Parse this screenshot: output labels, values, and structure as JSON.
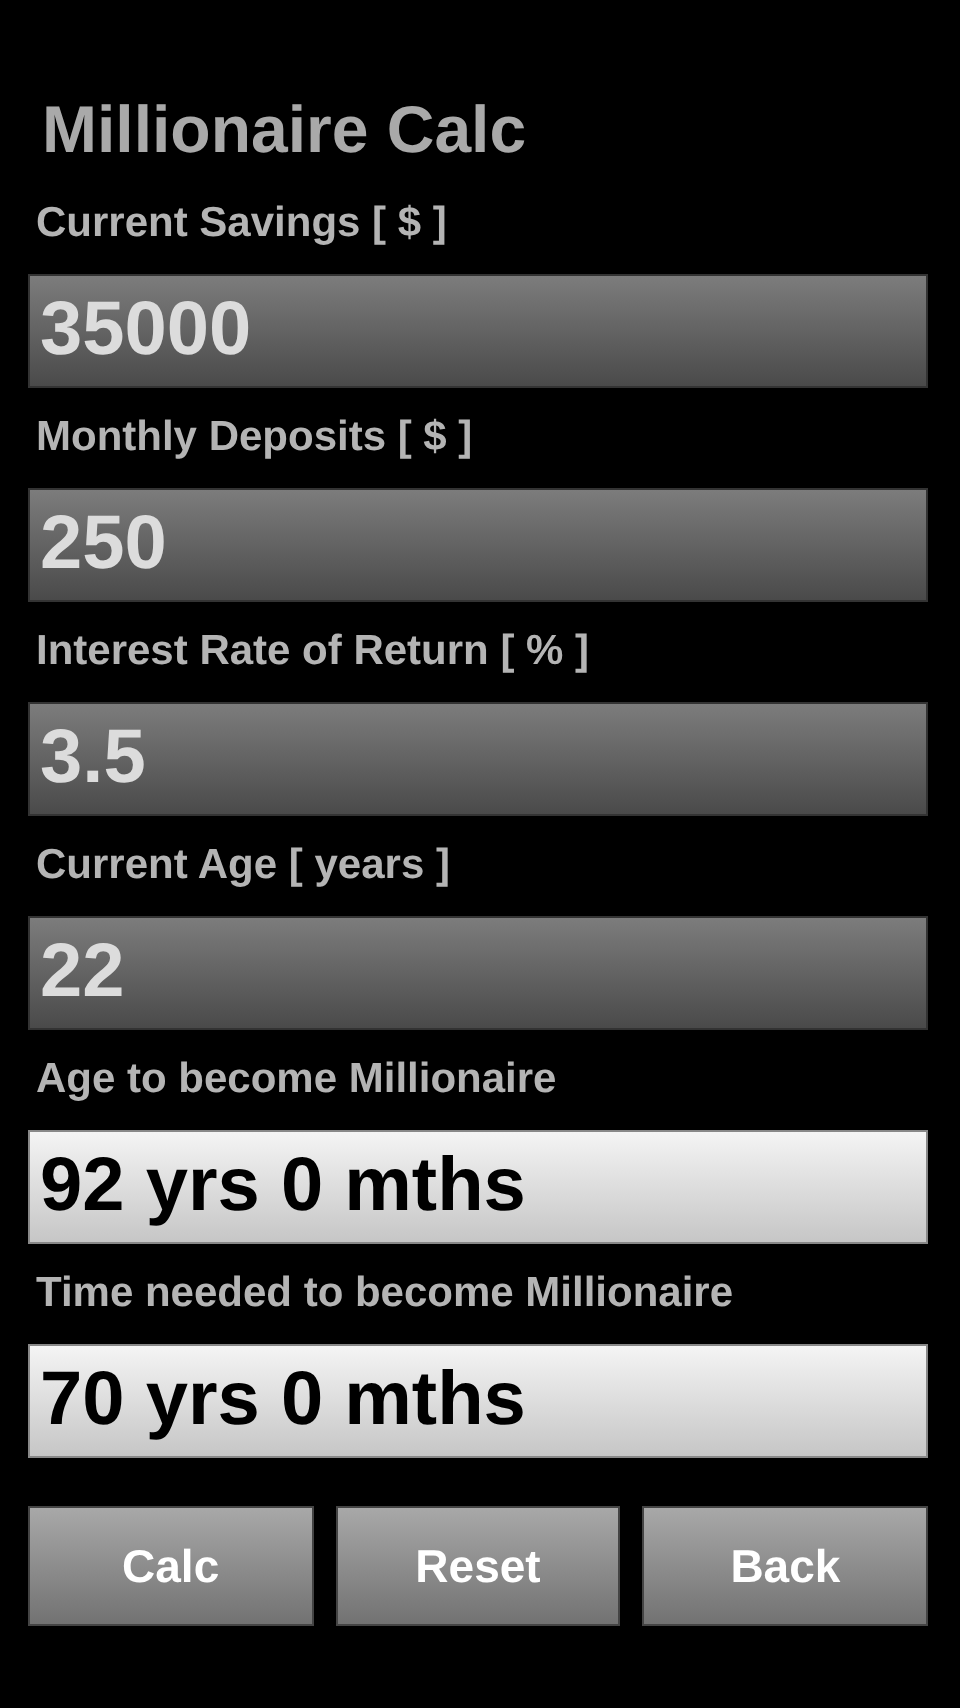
{
  "title": "Millionaire Calc",
  "fields": [
    {
      "kind": "input",
      "label": "Current Savings [ $ ]",
      "value": "35000"
    },
    {
      "kind": "input",
      "label": "Monthly Deposits [ $ ]",
      "value": "250"
    },
    {
      "kind": "input",
      "label": "Interest Rate of Return [ % ]",
      "value": "3.5"
    },
    {
      "kind": "input",
      "label": "Current Age [ years ]",
      "value": "22"
    },
    {
      "kind": "output",
      "label": "Age to become Millionaire",
      "value": "92 yrs 0 mths"
    },
    {
      "kind": "output",
      "label": "Time needed to become Millionaire",
      "value": "70 yrs 0 mths"
    }
  ],
  "buttons": [
    "Calc",
    "Reset",
    "Back"
  ]
}
